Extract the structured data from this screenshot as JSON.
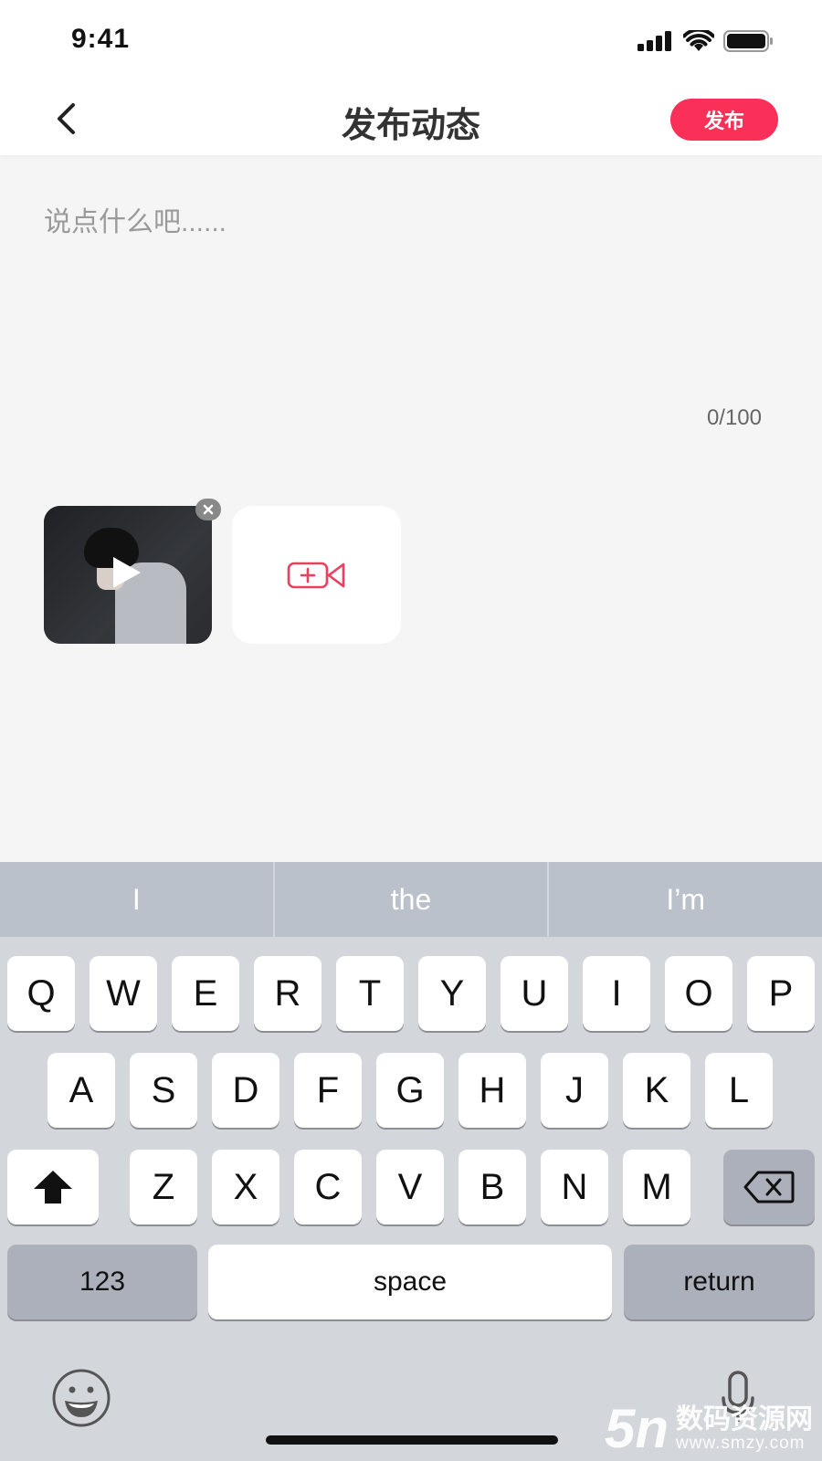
{
  "status_bar": {
    "time": "9:41",
    "icons": [
      "signal-icon",
      "wifi-icon",
      "battery-icon"
    ]
  },
  "nav": {
    "back_icon": "chevron-left-icon",
    "title": "发布动态",
    "publish_label": "发布",
    "accent": "#fa3058"
  },
  "compose": {
    "placeholder": "说点什么吧......",
    "value": "",
    "counter": "0/100",
    "max_length": 100
  },
  "media": {
    "items": [
      {
        "type": "video",
        "remove_icon": "close-icon",
        "play_icon": "play-icon"
      }
    ],
    "add_button_icon": "video-add-icon",
    "add_icon_color": "#e8415f"
  },
  "keyboard": {
    "suggestions": [
      "I",
      "the",
      "I’m"
    ],
    "row1": [
      "Q",
      "W",
      "E",
      "R",
      "T",
      "Y",
      "U",
      "I",
      "O",
      "P"
    ],
    "row2": [
      "A",
      "S",
      "D",
      "F",
      "G",
      "H",
      "J",
      "K",
      "L"
    ],
    "row3": [
      "Z",
      "X",
      "C",
      "V",
      "B",
      "N",
      "M"
    ],
    "shift_icon": "shift-icon",
    "delete_icon": "backspace-icon",
    "numbers_label": "123",
    "space_label": "space",
    "return_label": "return",
    "emoji_icon": "emoji-icon",
    "mic_icon": "microphone-icon"
  },
  "watermark": {
    "logo": "5n",
    "name": "数码资源网",
    "url": "www.smzy.com"
  }
}
